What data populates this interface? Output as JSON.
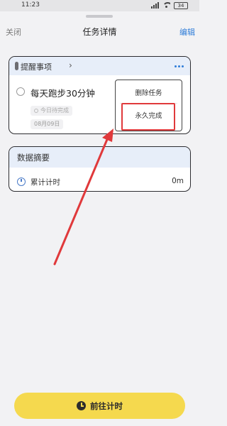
{
  "status_bar": {
    "time": "11:23",
    "battery": "34",
    "signal_icon": "signal-icon",
    "wifi_icon": "wifi-icon"
  },
  "header": {
    "close_label": "关闭",
    "title": "任务详情",
    "edit_label": "编辑"
  },
  "task": {
    "category_label": "提醒事项",
    "title": "每天跑步30分钟",
    "status_chip": "今日待完成",
    "date": "08月09日"
  },
  "context_menu": {
    "items": [
      {
        "label": "删除任务"
      },
      {
        "label": "永久完成"
      }
    ]
  },
  "summary": {
    "title": "数据摘要",
    "rows": [
      {
        "label": "累计计时",
        "value": "0m"
      }
    ]
  },
  "footer": {
    "button_label": "前往计时"
  },
  "colors": {
    "accent_blue": "#2f7dd8",
    "button_yellow": "#f5d94e",
    "annotation_red": "#e0393b"
  }
}
